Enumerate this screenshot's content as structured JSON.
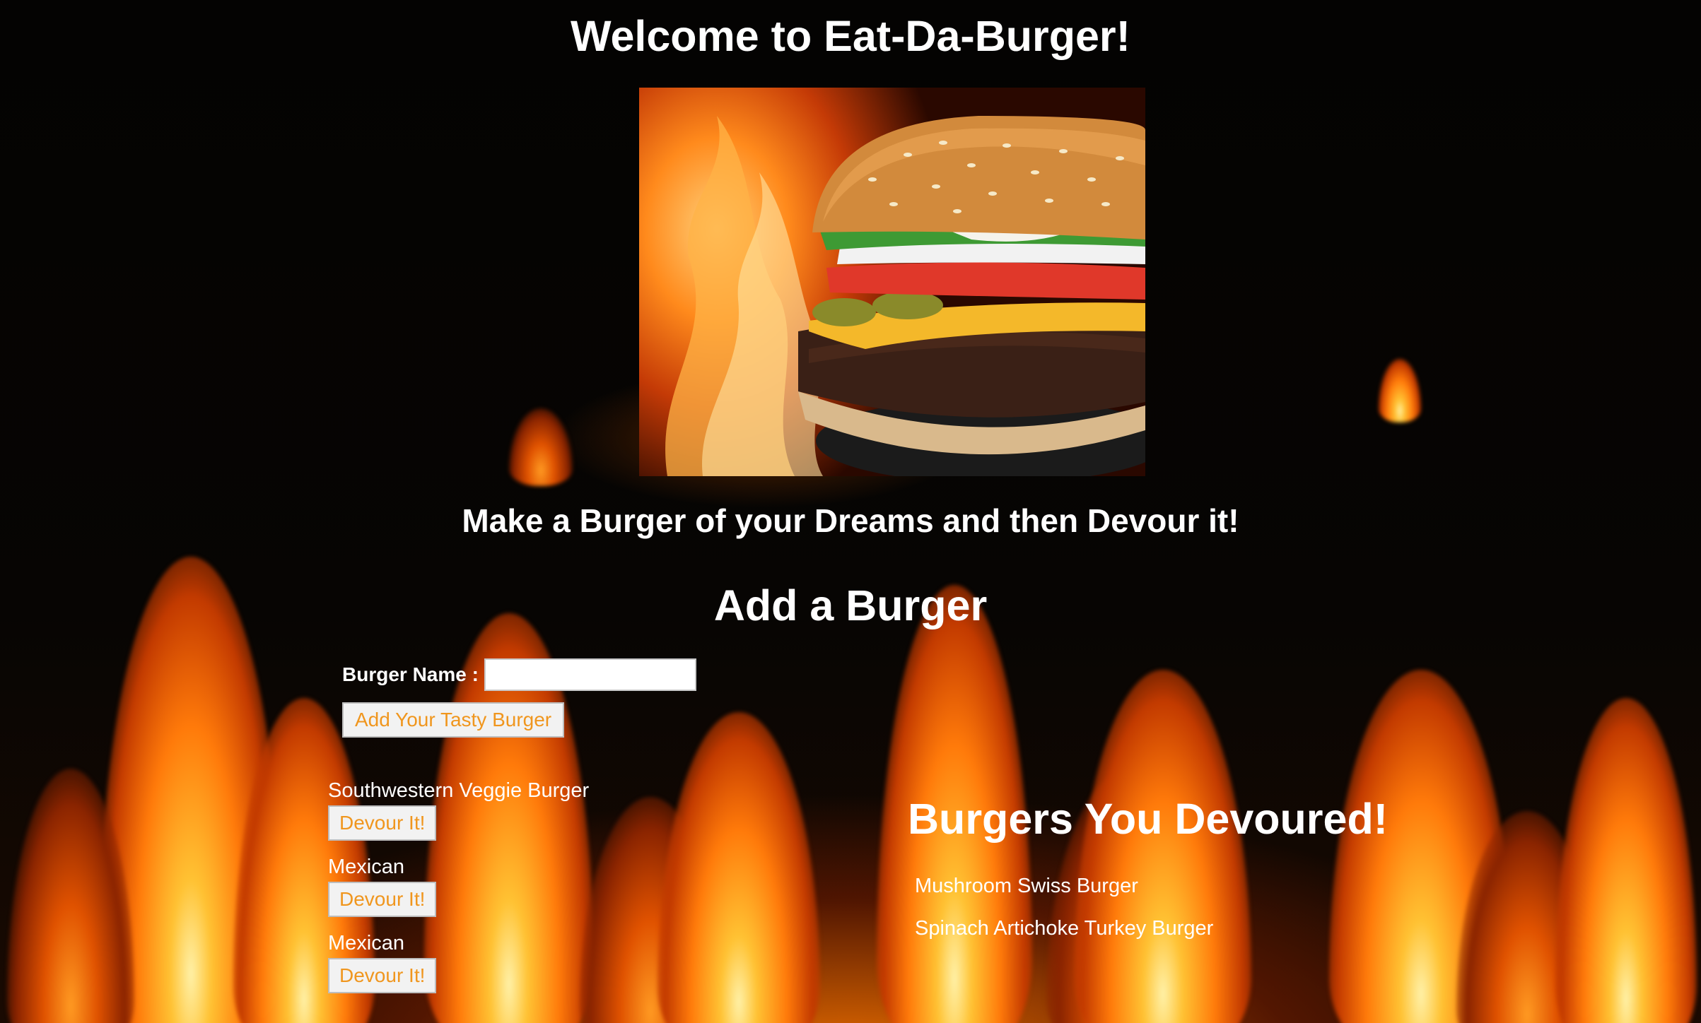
{
  "header": {
    "title": "Welcome to Eat-Da-Burger!"
  },
  "hero": {
    "image": "burger-photo"
  },
  "tagline": "Make a Burger of your Dreams and then Devour it!",
  "add_form": {
    "title": "Add a Burger",
    "label": "Burger Name :",
    "input_value": "",
    "submit_label": "Add Your Tasty Burger"
  },
  "burgers": [
    {
      "name": "Southwestern Veggie Burger",
      "button": "Devour It!"
    },
    {
      "name": "Mexican",
      "button": "Devour It!"
    },
    {
      "name": "Mexican",
      "button": "Devour It!"
    }
  ],
  "devoured": {
    "title": "Burgers You Devoured!",
    "items": [
      "Mushroom Swiss Burger",
      "Spinach Artichoke Turkey Burger"
    ]
  },
  "colors": {
    "button_text": "#f0961e",
    "button_bg": "#f2f2f2",
    "text": "#ffffff",
    "background": "#050403"
  }
}
